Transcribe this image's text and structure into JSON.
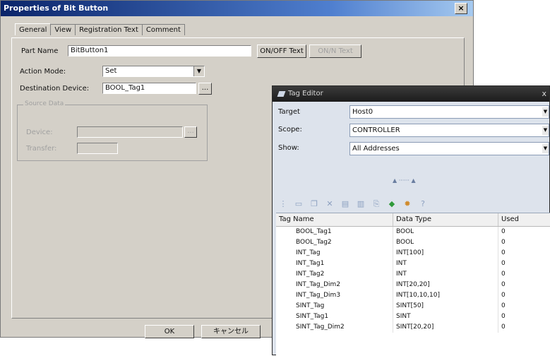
{
  "dialog": {
    "title": "Properties of Bit Button",
    "close": "×",
    "tabs": [
      "General",
      "View",
      "Registration Text",
      "Comment"
    ],
    "part_name_label": "Part Name",
    "part_name_value": "BitButton1",
    "off_text_button": "ON/OFF Text",
    "on_text_button": "ON/N Text",
    "action_mode_label": "Action Mode:",
    "action_mode_value": "Set",
    "destination_label": "Destination Device:",
    "destination_value": "BOOL_Tag1",
    "browse_button": "...",
    "group_title": "Source Data",
    "group_device_label": "Device:",
    "group_transfer_label": "Transfer:",
    "ok_button": "OK",
    "cancel_button": "キャンセル"
  },
  "tag_editor": {
    "title": "Tag Editor",
    "close": "x",
    "target_label": "Target",
    "target_value": "Host0",
    "scope_label": "Scope:",
    "scope_value": "CONTROLLER",
    "show_label": "Show:",
    "show_value": "All Addresses",
    "columns": [
      "Tag Name",
      "Data Type",
      "Used"
    ],
    "rows": [
      {
        "name": "BOOL_Tag1",
        "type": "BOOL",
        "used": "0"
      },
      {
        "name": "BOOL_Tag2",
        "type": "BOOL",
        "used": "0"
      },
      {
        "name": "INT_Tag",
        "type": "INT[100]",
        "used": "0"
      },
      {
        "name": "INT_Tag1",
        "type": "INT",
        "used": "0"
      },
      {
        "name": "INT_Tag2",
        "type": "INT",
        "used": "0"
      },
      {
        "name": "INT_Tag_Dim2",
        "type": "INT[20,20]",
        "used": "0"
      },
      {
        "name": "INT_Tag_Dim3",
        "type": "INT[10,10,10]",
        "used": "0"
      },
      {
        "name": "SINT_Tag",
        "type": "SINT[50]",
        "used": "0"
      },
      {
        "name": "SINT_Tag1",
        "type": "SINT",
        "used": "0"
      },
      {
        "name": "SINT_Tag_Dim2",
        "type": "SINT[20,20]",
        "used": "0"
      }
    ]
  }
}
